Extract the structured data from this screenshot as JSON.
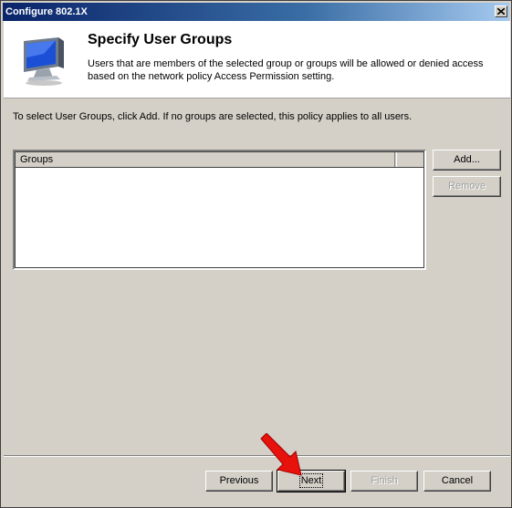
{
  "window": {
    "title": "Configure 802.1X"
  },
  "header": {
    "title": "Specify User Groups",
    "description": "Users that are members of the selected group or groups will be allowed or denied access based on the network policy Access Permission setting."
  },
  "instruction": "To select User Groups, click Add. If no groups are selected, this policy applies to all users.",
  "groups_list": {
    "column_header": "Groups",
    "items": []
  },
  "side_buttons": {
    "add": "Add...",
    "remove": "Remove"
  },
  "footer_buttons": {
    "previous": "Previous",
    "next": "Next",
    "finish": "Finish",
    "cancel": "Cancel"
  },
  "colors": {
    "arrow": "#e8120c",
    "title_bar": "#0a246a",
    "dialog_face": "#d4d0c8"
  }
}
